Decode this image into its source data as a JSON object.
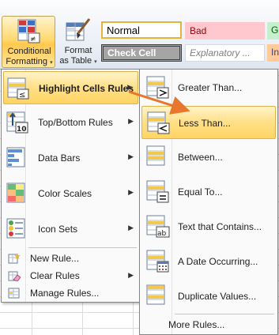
{
  "ribbon": {
    "conditional_formatting": {
      "line1": "Conditional",
      "line2": "Formatting"
    },
    "format_as_table": {
      "line1": "Format",
      "line2": "as Table"
    },
    "dropdown_glyph": "▾",
    "styles": {
      "normal": "Normal",
      "bad": "Bad",
      "good": "G",
      "check_cell": "Check Cell",
      "explanatory": "Explanatory ...",
      "input": "In"
    }
  },
  "menu": {
    "items": [
      {
        "label": "Highlight Cells Rules",
        "icon": "highlight-cells-icon",
        "highlighted": true,
        "has_submenu": true
      },
      {
        "label": "Top/Bottom Rules",
        "icon": "top-bottom-icon",
        "highlighted": false,
        "has_submenu": true
      },
      {
        "label": "Data Bars",
        "icon": "data-bars-icon",
        "highlighted": false,
        "has_submenu": true
      },
      {
        "label": "Color Scales",
        "icon": "color-scales-icon",
        "highlighted": false,
        "has_submenu": true
      },
      {
        "label": "Icon Sets",
        "icon": "icon-sets-icon",
        "highlighted": false,
        "has_submenu": true
      }
    ],
    "small_items": [
      {
        "label": "New Rule...",
        "icon": "new-rule-icon",
        "has_submenu": false
      },
      {
        "label": "Clear Rules",
        "icon": "clear-rules-icon",
        "has_submenu": true
      },
      {
        "label": "Manage Rules...",
        "icon": "manage-rules-icon",
        "has_submenu": false
      }
    ],
    "submenu_arrow": "▶"
  },
  "submenu": {
    "items": [
      {
        "label": "Greater Than...",
        "icon": "greater-than-icon",
        "highlighted": false
      },
      {
        "label": "Less Than...",
        "icon": "less-than-icon",
        "highlighted": true
      },
      {
        "label": "Between...",
        "icon": "between-icon",
        "highlighted": false
      },
      {
        "label": "Equal To...",
        "icon": "equal-to-icon",
        "highlighted": false
      },
      {
        "label": "Text that Contains...",
        "icon": "text-contains-icon",
        "highlighted": false
      },
      {
        "label": "A Date Occurring...",
        "icon": "date-occurring-icon",
        "highlighted": false
      },
      {
        "label": "Duplicate Values...",
        "icon": "duplicate-values-icon",
        "highlighted": false
      }
    ],
    "more_rules": "More Rules..."
  },
  "colors": {
    "highlight_top": "#fff3c9",
    "highlight_bottom": "#ffd464",
    "annotation_arrow": "#e8762d"
  }
}
